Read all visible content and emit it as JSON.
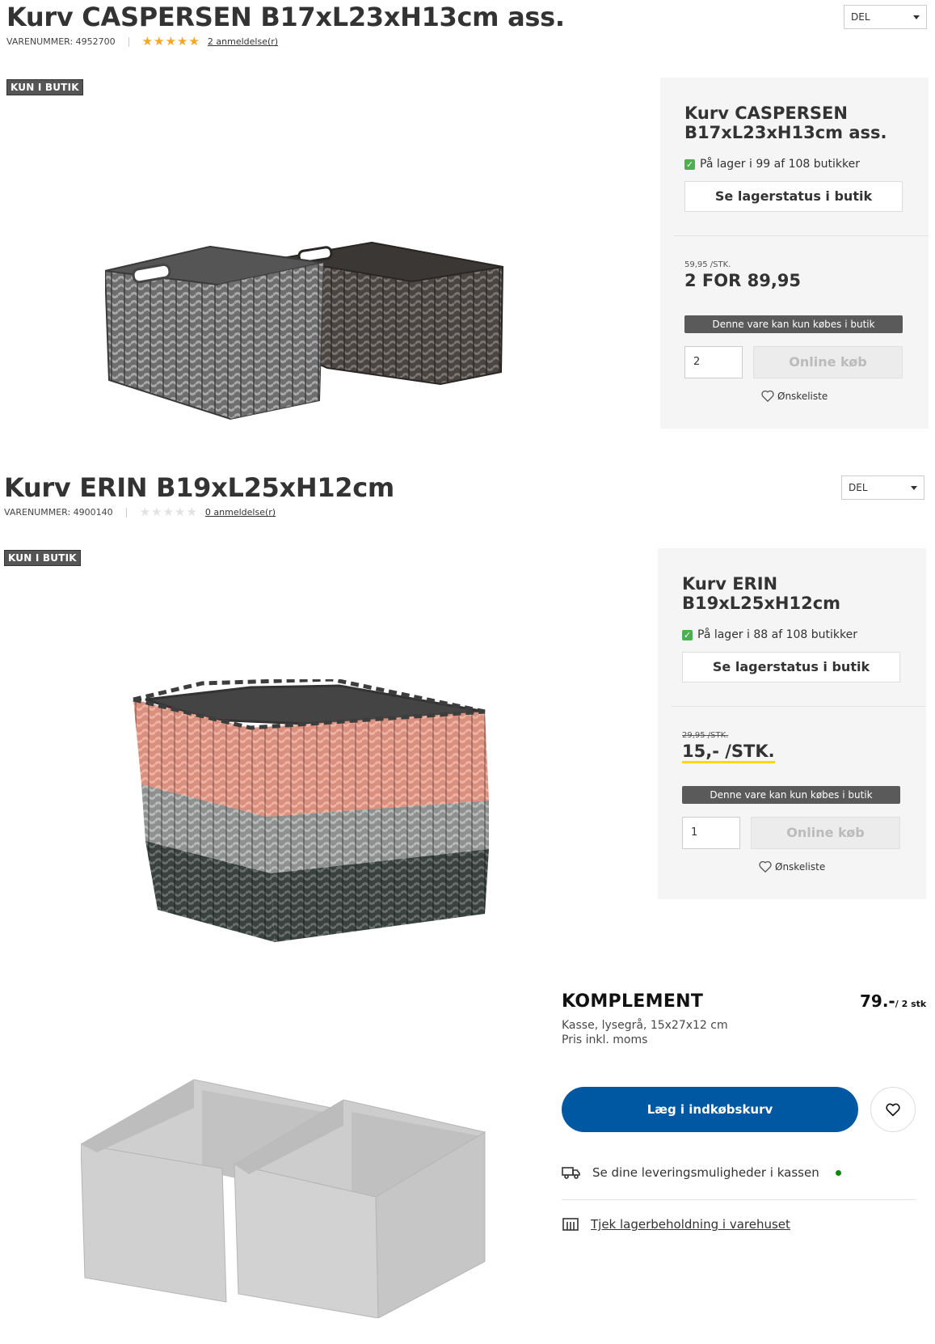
{
  "products": [
    {
      "title": "Kurv CASPERSEN B17xL23xH13cm ass.",
      "sku_label": "VARENUMMER: 4952700",
      "rating": 5,
      "reviews_label": "2 anmeldelse(r)",
      "share_label": "DEL",
      "badge": "KUN I BUTIK",
      "panel": {
        "title_line1": "Kurv CASPERSEN",
        "title_line2": "B17xL23xH13cm ass.",
        "stock": "På lager i 99 af 108 butikker",
        "status_button": "Se lagerstatus i butik",
        "unit_price": "59,95 /STK.",
        "price": "2 FOR 89,95",
        "store_only": "Denne vare kan kun købes i butik",
        "quantity": "2",
        "online_button": "Online køb",
        "wishlist": "Ønskeliste"
      }
    },
    {
      "title": "Kurv ERIN B19xL25xH12cm",
      "sku_label": "VARENUMMER: 4900140",
      "rating": 0,
      "reviews_label": "0 anmeldelse(r)",
      "share_label": "DEL",
      "badge": "KUN I BUTIK",
      "panel": {
        "title_line1": "Kurv ERIN",
        "title_line2": "B19xL25xH12cm",
        "stock": "På lager i 88 af 108 butikker",
        "status_button": "Se lagerstatus i butik",
        "old_price": "29,95 /STK.",
        "price": "15,- /STK.",
        "store_only": "Denne vare kan kun købes i butik",
        "quantity": "1",
        "online_button": "Online køb",
        "wishlist": "Ønskeliste"
      }
    }
  ],
  "ikea": {
    "name": "KOMPLEMENT",
    "description": "Kasse, lysegrå, 15x27x12 cm",
    "tax_note": "Pris inkl. moms",
    "price": "79.-",
    "price_unit": "/ 2 stk",
    "cart_button": "Læg i indkøbskurv",
    "delivery": "Se dine leveringsmuligheder i kassen",
    "stock_link": "Tjek lagerbeholdning i varehuset"
  },
  "colors": {
    "ikea_blue": "#0058a3",
    "star": "#f6a623",
    "stock_green": "#4caf50",
    "price_highlight": "#ffd800"
  }
}
